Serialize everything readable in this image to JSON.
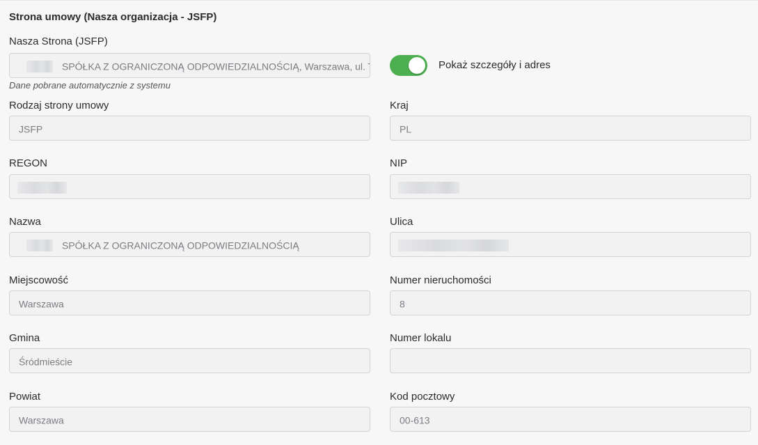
{
  "section": {
    "title": "Strona umowy (Nasza organizacja - JSFP)"
  },
  "our_party": {
    "label": "Nasza Strona (JSFP)",
    "value": "SPÓŁKA Z OGRANICZONĄ ODPOWIEDZIALNOŚCIĄ, Warszawa, ul. Tyt",
    "hint": "Dane pobrane automatycznie z systemu"
  },
  "details_toggle": {
    "label": "Pokaż szczegóły i adres",
    "on": true,
    "color": "#4caf50"
  },
  "fields": {
    "party_type": {
      "label": "Rodzaj strony umowy",
      "value": "JSFP"
    },
    "country": {
      "label": "Kraj",
      "value": "PL"
    },
    "regon": {
      "label": "REGON",
      "value": ""
    },
    "nip": {
      "label": "NIP",
      "value": ""
    },
    "name": {
      "label": "Nazwa",
      "value": "SPÓŁKA Z OGRANICZONĄ ODPOWIEDZIALNOŚCIĄ"
    },
    "street": {
      "label": "Ulica",
      "value": ""
    },
    "city": {
      "label": "Miejscowość",
      "value": "Warszawa"
    },
    "building_number": {
      "label": "Numer nieruchomości",
      "value": "8"
    },
    "municipality": {
      "label": "Gmina",
      "value": "Śródmieście"
    },
    "apartment_number": {
      "label": "Numer lokalu",
      "value": ""
    },
    "county": {
      "label": "Powiat",
      "value": "Warszawa"
    },
    "postal_code": {
      "label": "Kod pocztowy",
      "value": "00-613"
    }
  }
}
